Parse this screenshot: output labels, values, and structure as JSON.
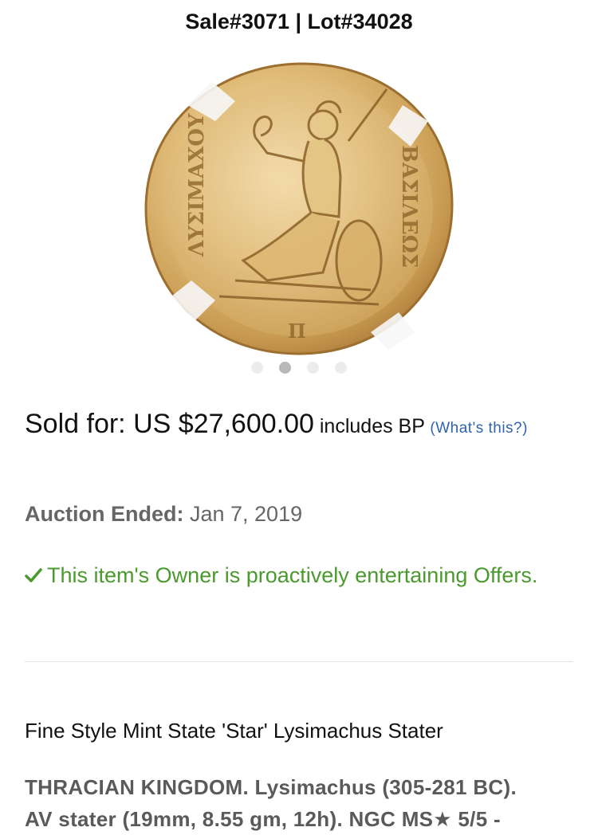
{
  "header": {
    "title": "Sale#3071 | Lot#34028"
  },
  "gallery": {
    "image_alt": "coin-image",
    "dots": [
      false,
      true,
      false,
      false
    ]
  },
  "price": {
    "sold_label": "Sold for: ",
    "amount": "US $27,600.00",
    "bp_text": " includes BP ",
    "whats_this": "(What's this?)"
  },
  "auction": {
    "ended_label": "Auction Ended:",
    "ended_date": " Jan 7, 2019"
  },
  "offers": {
    "text": "This item's Owner is proactively entertaining Offers."
  },
  "lot": {
    "title": "Fine Style Mint State 'Star' Lysimachus Stater",
    "description_line1": "THRACIAN KINGDOM. Lysimachus (305-281 BC).",
    "description_line2": "AV stater (19mm, 8.55 gm, 12h). NGC MS★ 5/5 -"
  },
  "colors": {
    "link": "#2f62b0",
    "offer_green": "#4a9a2d",
    "gold": "#d9b467"
  }
}
